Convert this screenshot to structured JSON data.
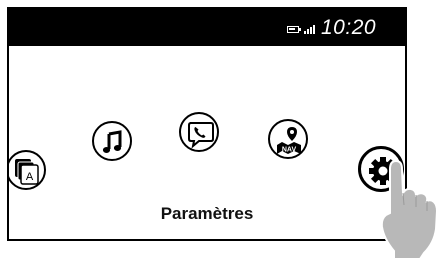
{
  "status_bar": {
    "time": "10:20",
    "icons": [
      "battery-icon",
      "signal-icon"
    ]
  },
  "carousel": {
    "items": [
      {
        "name": "apps",
        "icon": "apps-icon",
        "badge": "A"
      },
      {
        "name": "music",
        "icon": "music-note-icon"
      },
      {
        "name": "phone",
        "icon": "phone-icon"
      },
      {
        "name": "navigation",
        "icon": "nav-map-icon",
        "badge": "NAV"
      },
      {
        "name": "settings",
        "icon": "gear-icon",
        "selected": true
      }
    ],
    "selected_label": "Paramètres"
  },
  "colors": {
    "status_bar_bg": "#000000",
    "screen_bg": "#ffffff",
    "hand": "#b8b8b8"
  }
}
